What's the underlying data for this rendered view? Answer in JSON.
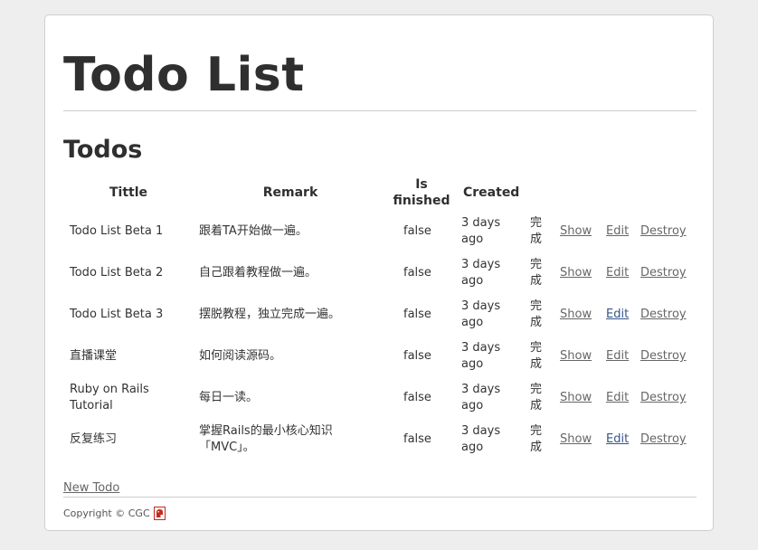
{
  "header": {
    "title": "Todo List"
  },
  "section": {
    "title": "Todos"
  },
  "table": {
    "columns": {
      "title": "Tittle",
      "remark": "Remark",
      "finished": "Is finished",
      "created": "Created"
    },
    "rows": [
      {
        "title": "Todo List Beta 1",
        "remark": "跟着TA开始做一遍。",
        "finished": "false",
        "created": "3 days ago",
        "status": "完成",
        "show": "Show",
        "edit": "Edit",
        "destroy": "Destroy"
      },
      {
        "title": "Todo List Beta 2",
        "remark": "自己跟着教程做一遍。",
        "finished": "false",
        "created": "3 days ago",
        "status": "完成",
        "show": "Show",
        "edit": "Edit",
        "destroy": "Destroy"
      },
      {
        "title": "Todo List Beta 3",
        "remark": "摆脱教程，独立完成一遍。",
        "finished": "false",
        "created": "3 days ago",
        "status": "完成",
        "show": "Show",
        "edit": "Edit",
        "destroy": "Destroy"
      },
      {
        "title": "直播课堂",
        "remark": "如何阅读源码。",
        "finished": "false",
        "created": "3 days ago",
        "status": "完成",
        "show": "Show",
        "edit": "Edit",
        "destroy": "Destroy"
      },
      {
        "title": "Ruby on Rails Tutorial",
        "remark": "每日一读。",
        "finished": "false",
        "created": "3 days ago",
        "status": "完成",
        "show": "Show",
        "edit": "Edit",
        "destroy": "Destroy"
      },
      {
        "title": "反复练习",
        "remark": "掌握Rails的最小核心知识「MVC」。",
        "finished": "false",
        "created": "3 days ago",
        "status": "完成",
        "show": "Show",
        "edit": "Edit",
        "destroy": "Destroy"
      }
    ]
  },
  "actions": {
    "new_todo": "New Todo"
  },
  "footer": {
    "copyright": "Copyright © CGC",
    "logo_icon": "cgc-logo-icon"
  },
  "colors": {
    "page_background": "#eeeeee",
    "card_background": "#ffffff",
    "link": "#666666",
    "link_visited": "#34548a",
    "logo_red": "#c8281e"
  }
}
